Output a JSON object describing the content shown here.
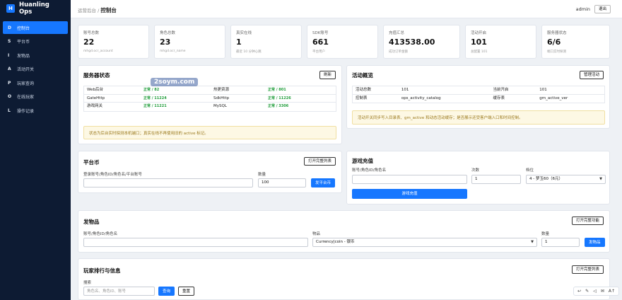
{
  "brand": {
    "logo": "H",
    "name": "Huanling Ops"
  },
  "nav": [
    {
      "key": "D",
      "label": "控制台",
      "active": true
    },
    {
      "key": "S",
      "label": "平台币"
    },
    {
      "key": "I",
      "label": "发物品"
    },
    {
      "key": "A",
      "label": "活动开关"
    },
    {
      "key": "P",
      "label": "玩家查询"
    },
    {
      "key": "O",
      "label": "在线玩家"
    },
    {
      "key": "L",
      "label": "操作记录"
    }
  ],
  "topbar": {
    "crumb": "运营后台",
    "sep": "/",
    "current": "控制台",
    "user": "admin",
    "logout": "退出"
  },
  "stats": [
    {
      "label": "账号总数",
      "value": "22",
      "sub": "mhgd.ocr_account"
    },
    {
      "label": "角色总数",
      "value": "23",
      "sub": "mhgd.ocr_name"
    },
    {
      "label": "真实在线",
      "value": "1",
      "sub": "最近 10 分钟心跳"
    },
    {
      "label": "SDK账号",
      "value": "661",
      "sub": "平台用户"
    },
    {
      "label": "充值汇总",
      "value": "413538.00",
      "sub": "成功订单金额"
    },
    {
      "label": "活动开启",
      "value": "101",
      "sub": "总配置 101"
    },
    {
      "label": "服务器状态",
      "value": "6/6",
      "sub": "端口实时探测"
    }
  ],
  "server": {
    "title": "服务器状态",
    "refresh": "刷新",
    "rows": [
      {
        "a": "Web后台",
        "as": "正常 / 82",
        "b": "热更资源",
        "bs": "正常 / 801"
      },
      {
        "a": "GateHttp",
        "as": "正常 / 11224",
        "b": "SdkHttp",
        "bs": "正常 / 11226"
      },
      {
        "a": "游戏网关",
        "as": "正常 / 11221",
        "b": "MySQL",
        "bs": "正常 / 3306"
      }
    ],
    "notice": "状态为后台实时探测本机端口；真实在线不再使用旧的 active 标记。"
  },
  "activity": {
    "title": "活动概览",
    "manage": "管理活动",
    "rows": [
      {
        "k1": "活动总数",
        "v1": "101",
        "k2": "当前开启",
        "v2": "101"
      },
      {
        "k1": "控制表",
        "v1": "ops_activity_catalog",
        "k2": "缓存表",
        "v2": "gm_active_ver"
      }
    ],
    "notice": "活动开关同步写入目录表、gm_active 和动态活动缓存；是否展示还受客户端入口和时间控制。"
  },
  "coin": {
    "title": "平台币",
    "open": "打开完整列表",
    "account_label": "登录账号/角色ID/角色名/平台账号",
    "account_value": "",
    "qty_label": "数量",
    "qty_value": "100",
    "submit": "发平台币"
  },
  "recharge": {
    "title": "游戏充值",
    "account_label": "账号/角色ID/角色名",
    "account_value": "",
    "times_label": "次数",
    "times_value": "1",
    "tier_label": "档位",
    "tier_value": "4 - 梦玉60（6元）",
    "submit": "游戏充值"
  },
  "items": {
    "title": "发物品",
    "open": "打开完整功能",
    "account_label": "账号/角色ID/角色名",
    "account_value": "",
    "item_label": "物品",
    "item_value": "Currency|coin - 银币",
    "qty_label": "数量",
    "qty_value": "1",
    "submit": "发物品"
  },
  "rank": {
    "title": "玩家排行与信息",
    "open": "打开完整列表",
    "search_label": "搜索",
    "search_placeholder": "角色名、角色ID、账号",
    "query": "查询",
    "reset": "重置"
  },
  "watermark": "2soym.com",
  "toolbar": {
    "a": "↩",
    "b": "✎",
    "c": "◁",
    "d": "✉",
    "e": "A↑"
  }
}
